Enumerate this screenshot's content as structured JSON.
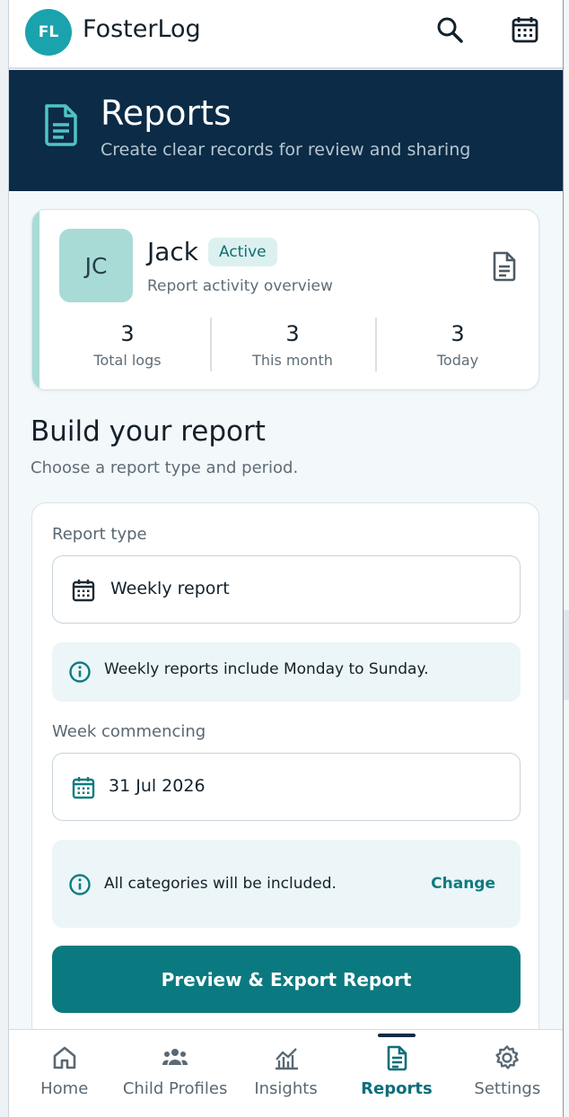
{
  "app": {
    "logo_initials": "FL",
    "name": "FosterLog"
  },
  "header": {
    "title": "Reports",
    "subtitle": "Create clear records for review and sharing"
  },
  "child": {
    "initials": "JC",
    "name": "Jack",
    "status": "Active",
    "subtitle": "Report activity overview",
    "stats": [
      {
        "value": "3",
        "label": "Total logs"
      },
      {
        "value": "3",
        "label": "This month"
      },
      {
        "value": "3",
        "label": "Today"
      }
    ]
  },
  "builder": {
    "title": "Build your report",
    "subtitle": "Choose a report type and period.",
    "report_type_label": "Report type",
    "report_type_value": "Weekly report",
    "report_type_info": "Weekly reports include Monday to Sunday.",
    "week_label": "Week commencing",
    "week_value": "31 Jul 2026",
    "categories_info": "All categories will be included.",
    "change_label": "Change",
    "export_label": "Preview & Export Report"
  },
  "nav": [
    {
      "label": "Home",
      "icon": "home-icon"
    },
    {
      "label": "Child Profiles",
      "icon": "people-icon"
    },
    {
      "label": "Insights",
      "icon": "chart-icon"
    },
    {
      "label": "Reports",
      "icon": "document-icon",
      "active": true
    },
    {
      "label": "Settings",
      "icon": "gear-icon"
    }
  ],
  "colors": {
    "brand": "#1aa3ad",
    "header_bg": "#0b2b46",
    "primary": "#0b7a80"
  }
}
